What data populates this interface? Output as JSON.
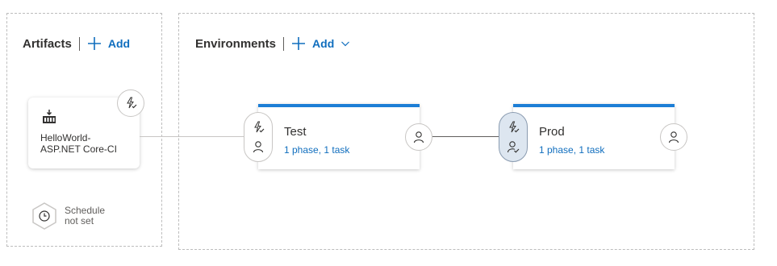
{
  "artifacts": {
    "title": "Artifacts",
    "add_label": "Add",
    "artifact": {
      "name_line1": "HelloWorld-",
      "name_line2": "ASP.NET Core-CI",
      "icon": "build-pipeline-icon",
      "trigger_icon": "continuous-deployment-trigger-icon"
    },
    "schedule": {
      "line1": "Schedule",
      "line2": "not set",
      "icon": "clock-icon"
    }
  },
  "environments": {
    "title": "Environments",
    "add_label": "Add",
    "stages": [
      {
        "name": "Test",
        "summary": "1 phase, 1 task",
        "pre_icons": [
          "trigger-icon",
          "pre-deployment-approvers-icon"
        ],
        "post_icon": "post-deployment-approvers-icon"
      },
      {
        "name": "Prod",
        "summary": "1 phase, 1 task",
        "pre_icons": [
          "trigger-icon",
          "pre-deployment-approvers-checked-icon"
        ],
        "post_icon": "post-deployment-approvers-icon"
      }
    ]
  },
  "colors": {
    "accent": "#1c7ed6",
    "link": "#106ebe",
    "selected_pill": "#dde6f0"
  }
}
